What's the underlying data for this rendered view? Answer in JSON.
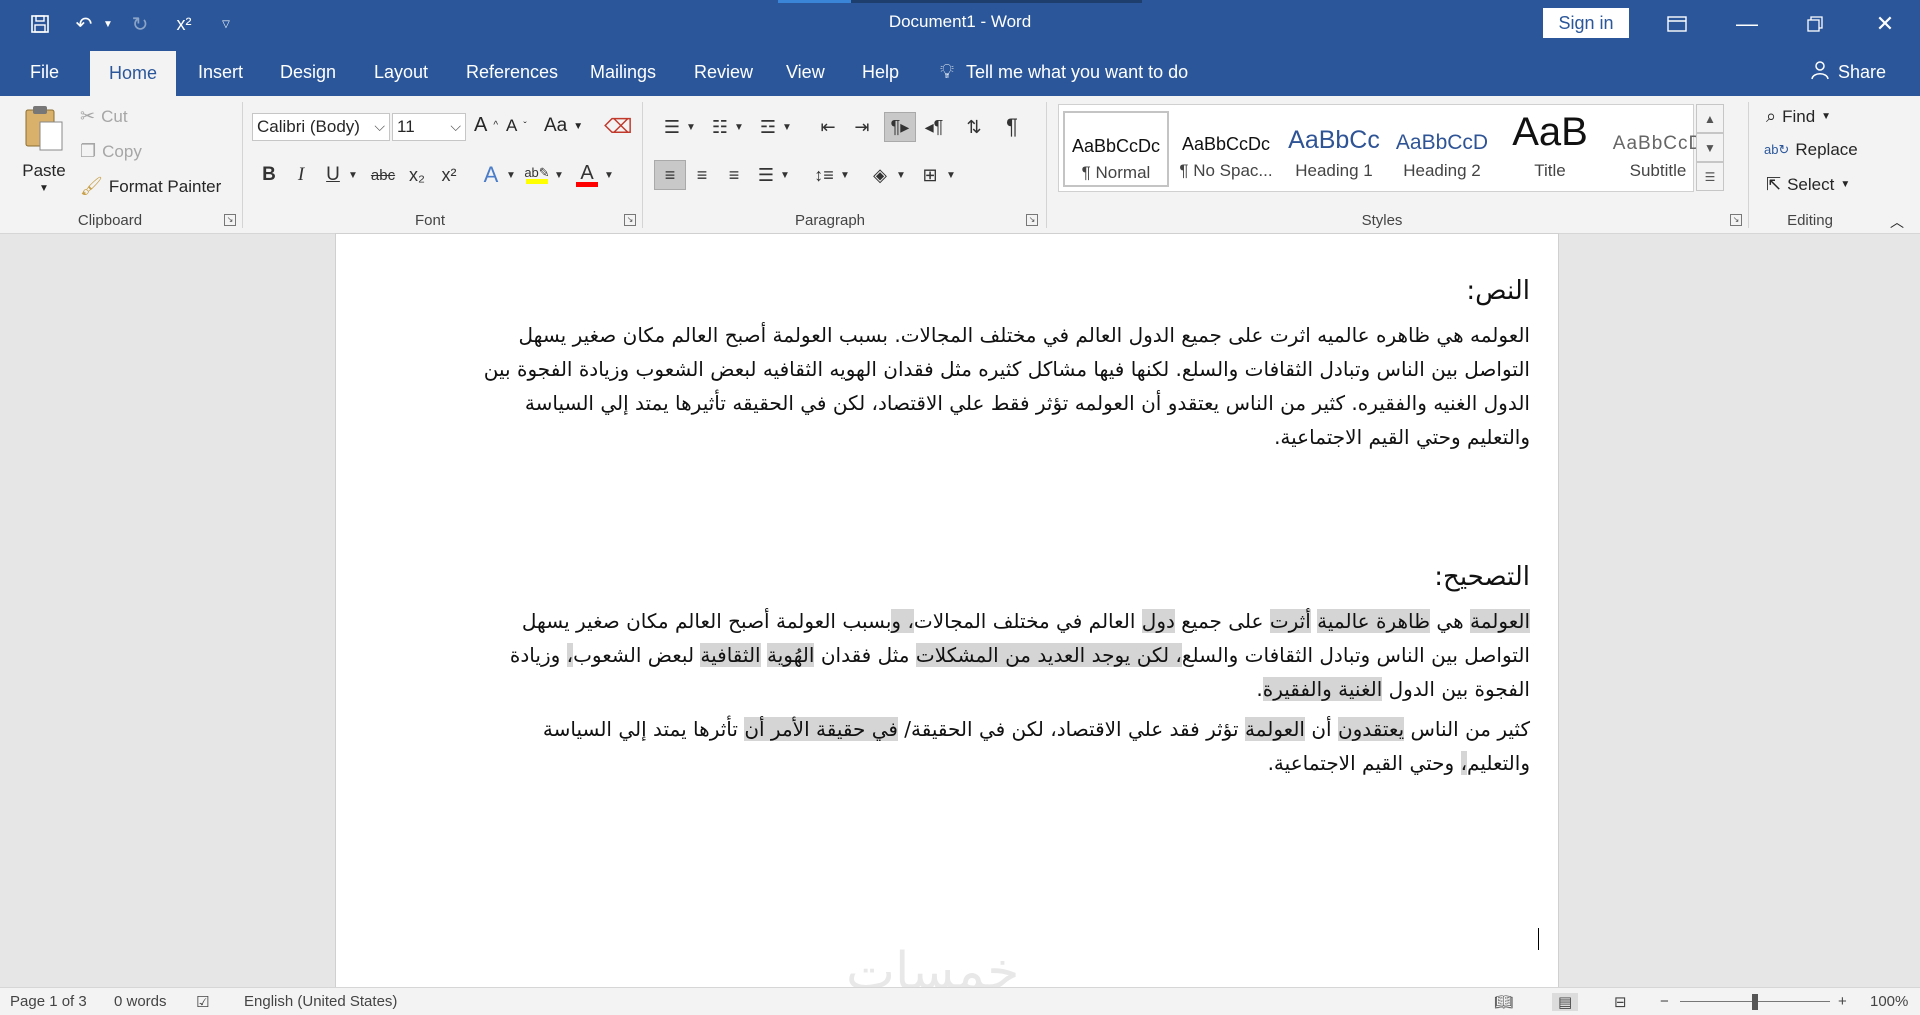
{
  "window": {
    "doc_title": "Document1  -  Word",
    "sign_in": "Sign in",
    "progress_fraction": 0.2,
    "accent_color": "#2b579a"
  },
  "qat": {
    "icons": [
      "save-icon",
      "undo-icon",
      "redo-icon",
      "superscript-icon",
      "customize-icon"
    ],
    "superscript_label": "x²"
  },
  "tabs": [
    "File",
    "Home",
    "Insert",
    "Design",
    "Layout",
    "References",
    "Mailings",
    "Review",
    "View",
    "Help"
  ],
  "active_tab": "Home",
  "tell_me": "Tell me what you want to do",
  "share": "Share",
  "clipboard": {
    "paste": "Paste",
    "cut": "Cut",
    "copy": "Copy",
    "format_painter": "Format Painter",
    "group": "Clipboard"
  },
  "font": {
    "name": "Calibri (Body)",
    "size": "11",
    "group": "Font",
    "change_case": "Aa",
    "grow": "A",
    "shrink": "A",
    "bold": "B",
    "italic": "I",
    "underline": "U",
    "strike": "abc",
    "subscript": "x₂",
    "superscript": "x²",
    "highlight_color": "#ffff00",
    "font_color": "#ff0000"
  },
  "paragraph": {
    "group": "Paragraph"
  },
  "styles": {
    "group": "Styles",
    "items": [
      {
        "sample": "AaBbCcDc",
        "name": "¶ Normal"
      },
      {
        "sample": "AaBbCcDc",
        "name": "¶ No Spac..."
      },
      {
        "sample": "AaBbCc",
        "name": "Heading 1"
      },
      {
        "sample": "AaBbCcD",
        "name": "Heading 2"
      },
      {
        "sample": "AaB",
        "name": "Title"
      },
      {
        "sample": "AaBbCcD",
        "name": "Subtitle"
      }
    ]
  },
  "editing": {
    "group": "Editing",
    "find": "Find",
    "replace": "Replace",
    "select": "Select"
  },
  "document": {
    "heading1": "النص:",
    "para1": "العولمه هي ظاهره عالميه اثرت على جميع الدول العالم في مختلف المجالات. بسبب العولمة أصبح العالم مكان صغير يسهل التواصل بين الناس وتبادل الثقافات والسلع. لكنها فيها مشاكل كثيره مثل فقدان الهويه الثقافيه لبعض الشعوب وزيادة الفجوة بين الدول الغنيه والفقيره. كثير من الناس يعتقدو أن العولمه تؤثر فقط علي الاقتصاد، لكن في الحقيقه تأثيرها يمتد إلي السياسة والتعليم وحتي القيم الاجتماعية.",
    "heading2": "التصحيح:",
    "p2": [
      {
        "t": "العولمة",
        "h": true
      },
      {
        "t": " هي ",
        "h": false
      },
      {
        "t": "ظاهرة عالمية",
        "h": true
      },
      {
        "t": " ",
        "h": false
      },
      {
        "t": "أثرت",
        "h": true
      },
      {
        "t": " على جميع ",
        "h": false
      },
      {
        "t": "دول",
        "h": true
      },
      {
        "t": " العالم في مختلف المجالات",
        "h": false
      },
      {
        "t": "، و",
        "h": true
      },
      {
        "t": "بسبب العولمة أصبح العالم مكان صغير يسهل التواصل بين الناس وتبادل الثقافات والسلع",
        "h": false
      },
      {
        "t": "، ",
        "h": true
      },
      {
        "t": "لكن يوجد العديد من المشكلات",
        "h": true
      },
      {
        "t": " مثل فقدان ",
        "h": false
      },
      {
        "t": "الهُوية",
        "h": true
      },
      {
        "t": " ",
        "h": false
      },
      {
        "t": "الثقافية",
        "h": true
      },
      {
        "t": " لبعض الشعوب",
        "h": false
      },
      {
        "t": "،",
        "h": true
      },
      {
        "t": " وزيادة الفجوة بين الدول ",
        "h": false
      },
      {
        "t": "الغنية والفقيرة",
        "h": true
      },
      {
        "t": ".",
        "h": false
      }
    ],
    "p3": [
      {
        "t": "كثير من الناس ",
        "h": false
      },
      {
        "t": "يعتقدون",
        "h": true
      },
      {
        "t": " أن ",
        "h": false
      },
      {
        "t": "العولمة",
        "h": true
      },
      {
        "t": " تؤثر فقد علي الاقتصاد، لكن في الحقيقة/ ",
        "h": false
      },
      {
        "t": "في حقيقة الأمر أن",
        "h": true
      },
      {
        "t": " تأثرها يمتد إلي السياسة والتعليم",
        "h": false
      },
      {
        "t": "،",
        "h": true
      },
      {
        "t": " وحتي القيم الاجتماعية.",
        "h": false
      }
    ],
    "watermark": "خمسات"
  },
  "status": {
    "page": "Page 1 of 3",
    "words": "0 words",
    "language": "English (United States)",
    "zoom": "100%",
    "zoom_level": 1.0
  }
}
